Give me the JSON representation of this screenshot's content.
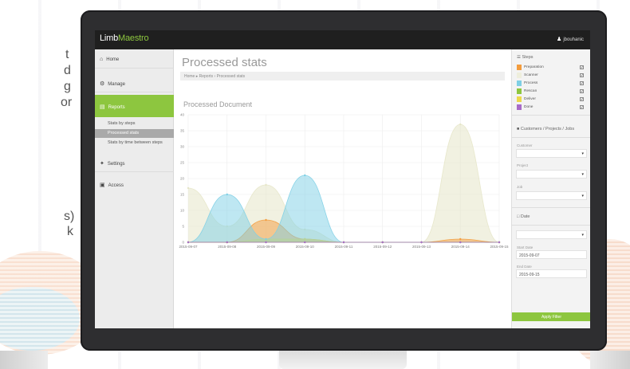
{
  "window": {
    "logo_limb": "Limb",
    "logo_maestro": "Maestro",
    "user_name": "jbouhanic"
  },
  "sidebar": {
    "items": [
      {
        "label": "Home",
        "icon": "home-icon"
      },
      {
        "label": "Manage",
        "icon": "gear-icon"
      },
      {
        "label": "Reports",
        "icon": "bar-chart-icon"
      },
      {
        "label": "Settings",
        "icon": "wrench-icon"
      },
      {
        "label": "Access",
        "icon": "lock-icon"
      }
    ],
    "sub_items": [
      {
        "label": "Stats by steps"
      },
      {
        "label": "Processed stats"
      },
      {
        "label": "Stats by time between steps"
      }
    ]
  },
  "main": {
    "page_title": "Processed stats",
    "breadcrumb": "Home ▸ Reports › Processed stats",
    "chart_title": "Processed Document"
  },
  "right_panel": {
    "steps_title": "Steps",
    "steps": [
      {
        "label": "Preparation",
        "color": "#f39c3d",
        "checked": true
      },
      {
        "label": "Scanner",
        "color": "#eeeedc",
        "checked": true
      },
      {
        "label": "Process",
        "color": "#7ecfe5",
        "checked": true
      },
      {
        "label": "Rescan",
        "color": "#8dc63f",
        "checked": true
      },
      {
        "label": "Deliver",
        "color": "#ecd94a",
        "checked": true
      },
      {
        "label": "Done",
        "color": "#a86bc8",
        "checked": true
      }
    ],
    "filter_title": "Customers / Projects / Jobs",
    "customer_label": "Customer",
    "project_label": "Project",
    "job_label": "Job",
    "date_title": "Date",
    "start_label": "Start Date",
    "start_value": "2015-09-07",
    "end_label": "End Date",
    "end_value": "2015-09-15",
    "apply_label": "Apply Filter"
  },
  "background": {
    "fragments": [
      "t",
      "d",
      "g",
      "or",
      "s)",
      "k"
    ]
  },
  "chart_data": {
    "type": "area",
    "title": "Processed Document",
    "x": [
      "2015-09-07",
      "2015-09-08",
      "2015-09-09",
      "2015-09-10",
      "2015-09-11",
      "2015-09-12",
      "2015-09-13",
      "2015-09-14",
      "2015-09-15"
    ],
    "ylim": [
      0,
      40
    ],
    "yticks": [
      0,
      5,
      10,
      15,
      20,
      25,
      30,
      35,
      40
    ],
    "grid": true,
    "series": [
      {
        "name": "Preparation",
        "color": "#f39c3d",
        "values": [
          0,
          0,
          7,
          1,
          0,
          0,
          0,
          1,
          0
        ]
      },
      {
        "name": "Scanner",
        "color": "#e6e6c8",
        "values": [
          17,
          5,
          18,
          4,
          0,
          0,
          0,
          37,
          0
        ]
      },
      {
        "name": "Process",
        "color": "#7ecfe5",
        "values": [
          0,
          15,
          1,
          21,
          0,
          0,
          0,
          0,
          0
        ]
      },
      {
        "name": "Rescan",
        "color": "#8dc63f",
        "values": [
          0,
          0,
          0,
          0,
          0,
          0,
          0,
          0,
          0
        ]
      },
      {
        "name": "Deliver",
        "color": "#ecd94a",
        "values": [
          0,
          0,
          1,
          1,
          0,
          0,
          0,
          0,
          0
        ]
      },
      {
        "name": "Done",
        "color": "#a86bc8",
        "values": [
          0,
          0,
          0,
          0,
          0,
          0,
          0,
          0,
          0
        ]
      }
    ]
  }
}
